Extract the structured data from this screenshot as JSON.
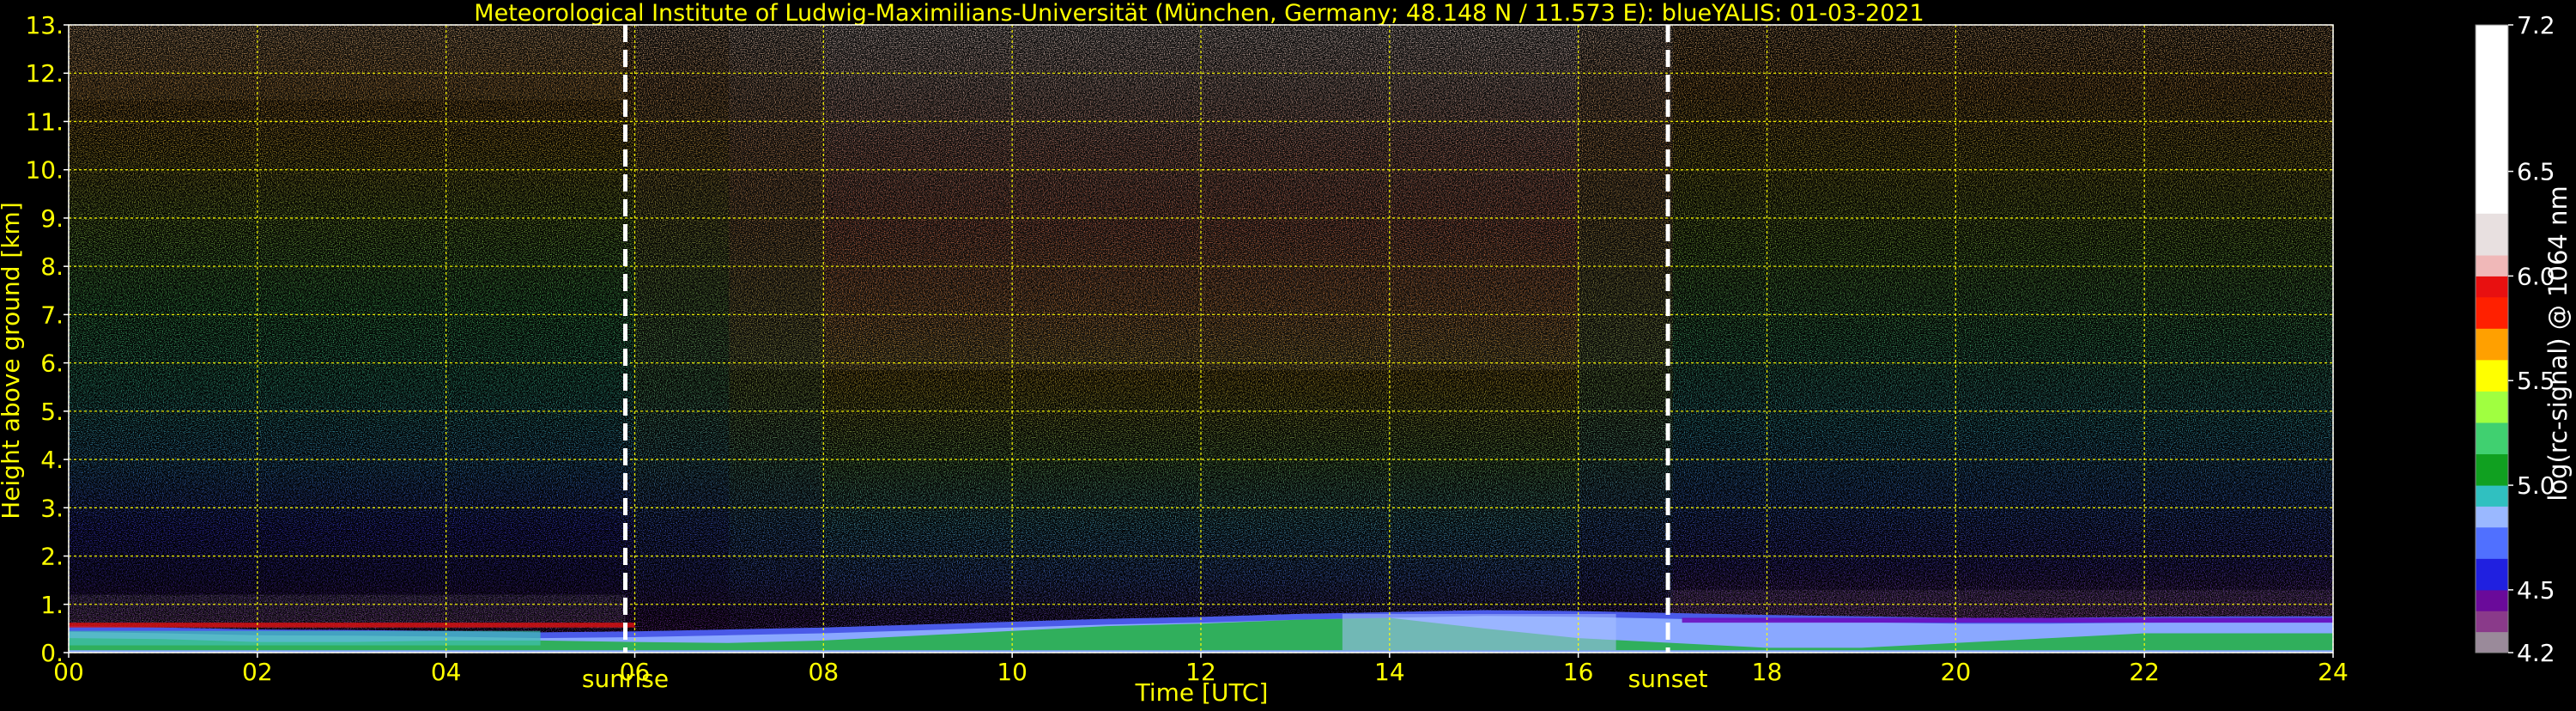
{
  "chart_data": {
    "type": "heatmap",
    "title": "Meteorological Institute of Ludwig-Maximilians-Universität (München, Germany; 48.148 N / 11.573 E):     blueYALIS: 01-03-2021",
    "xlabel": "Time [UTC]",
    "ylabel": "Height above ground [km]",
    "xlim": [
      0,
      24
    ],
    "ylim": [
      0,
      13
    ],
    "x_ticks": [
      0,
      2,
      4,
      6,
      8,
      10,
      12,
      14,
      16,
      18,
      20,
      22,
      24
    ],
    "x_tick_labels": [
      "00",
      "02",
      "04",
      "06",
      "08",
      "10",
      "12",
      "14",
      "16",
      "18",
      "20",
      "22",
      "24"
    ],
    "y_ticks": [
      0,
      1,
      2,
      3,
      4,
      5,
      6,
      7,
      8,
      9,
      10,
      11,
      12,
      13
    ],
    "y_tick_labels": [
      "0.",
      "1.",
      "2.",
      "3.",
      "4.",
      "5.",
      "6.",
      "7.",
      "8.",
      "9.",
      "10.",
      "11.",
      "12.",
      "13."
    ],
    "grid": true,
    "annotations": [
      {
        "label": "sunrise",
        "x": 5.9
      },
      {
        "label": "sunset",
        "x": 16.95
      }
    ],
    "colorbar": {
      "label": "log(rc-signal) @ 1064 nm",
      "range": [
        4.2,
        7.2
      ],
      "tick_values": [
        4.2,
        4.5,
        5.0,
        5.5,
        6.0,
        6.5,
        7.2
      ],
      "tick_labels": [
        "4.2",
        "4.5",
        "5.0",
        "5.5",
        "6.0",
        "6.5",
        "7.2"
      ],
      "stops": [
        {
          "v": 4.2,
          "c": "#9a8a9a"
        },
        {
          "v": 4.3,
          "c": "#8a3a8a"
        },
        {
          "v": 4.4,
          "c": "#6a0a9a"
        },
        {
          "v": 4.5,
          "c": "#2020e0"
        },
        {
          "v": 4.65,
          "c": "#5070ff"
        },
        {
          "v": 4.8,
          "c": "#9ab8ff"
        },
        {
          "v": 4.9,
          "c": "#30c0c0"
        },
        {
          "v": 5.0,
          "c": "#10a020"
        },
        {
          "v": 5.15,
          "c": "#40d070"
        },
        {
          "v": 5.3,
          "c": "#a0ff40"
        },
        {
          "v": 5.45,
          "c": "#ffff00"
        },
        {
          "v": 5.6,
          "c": "#ffa000"
        },
        {
          "v": 5.75,
          "c": "#ff2000"
        },
        {
          "v": 5.9,
          "c": "#e81010"
        },
        {
          "v": 6.0,
          "c": "#f0b8b8"
        },
        {
          "v": 6.1,
          "c": "#e8e0e0"
        },
        {
          "v": 6.3,
          "c": "#ffffff"
        },
        {
          "v": 7.2,
          "c": "#ffffff"
        }
      ]
    },
    "colors": {
      "text": "#ffff00",
      "grid": "#ffff00",
      "marker_lines": "#ffffff",
      "background": "#000000"
    }
  }
}
